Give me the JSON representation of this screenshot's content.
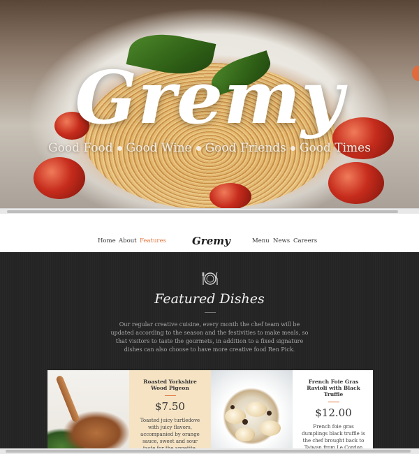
{
  "hero": {
    "brand": "Gremy",
    "tagline": [
      "Good Food",
      "Good Wine",
      "Good Friends",
      "Good Times"
    ]
  },
  "nav": {
    "left_items": [
      "Home",
      "About",
      "Features"
    ],
    "active_item": "Features",
    "brand": "Gremy",
    "right_items": [
      "Menu",
      "News",
      "Careers"
    ]
  },
  "featured": {
    "icon": "cutlery-plate-icon",
    "title": "Featured Dishes",
    "intro": "Our regular creative cuisine, every month the chef team will be updated according to the season and the festivities to make meals, so that visitors to taste the gourmets, in addition to a fixed signature dishes can also choose to have more creative food Ren Pick.",
    "dishes": [
      {
        "name": "Roasted Yorkshire Wood Pigeon",
        "price": "$7.50",
        "description": "Toasted juicy turtledove with juicy flavors, accompanied by orange sauce, sweet and sour taste for the appetite, may wish to give it a try.",
        "image": "roasted-pigeon-photo"
      },
      {
        "name": "French Foie Gras Ravioli with Black Truffle",
        "price": "$12.00",
        "description": "French foie gras dumplings black truffle is the chef brought back to Taiwan from Le Cordon Bleu delicious dishes, the combination of gras dumplings",
        "image": "foie-gras-ravioli-photo"
      }
    ]
  },
  "colors": {
    "accent": "#e0763f",
    "section_bg": "#242424",
    "card_tan": "#f5e3c4",
    "card_white": "#ffffff"
  }
}
